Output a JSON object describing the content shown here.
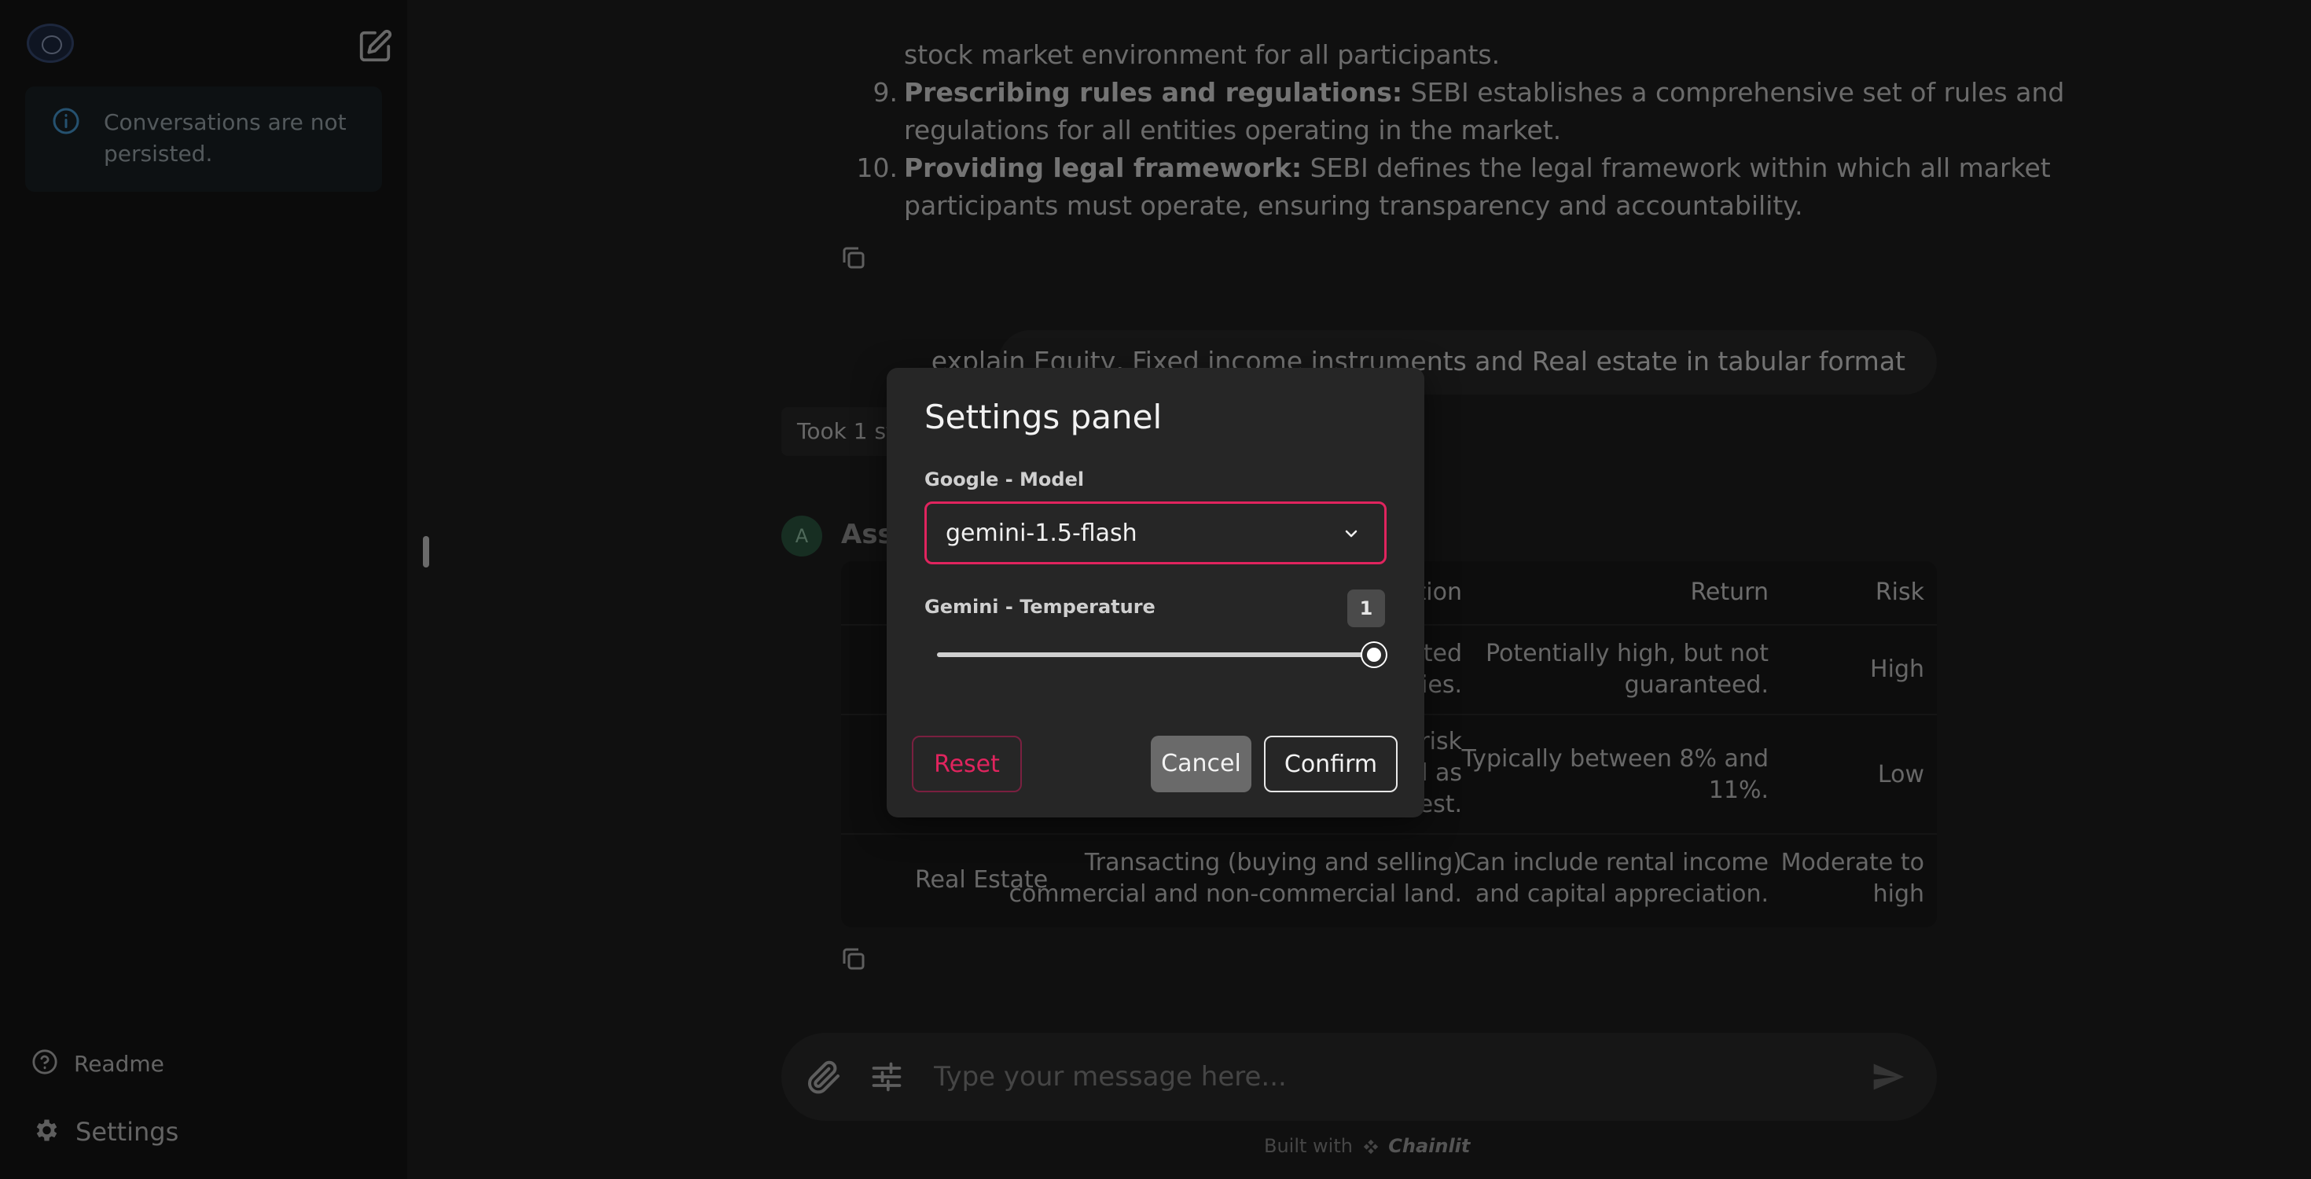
{
  "sidebar": {
    "logo": "app-logo",
    "info_notice": "Conversations are not persisted.",
    "readme_label": "Readme",
    "settings_label": "Settings"
  },
  "chat": {
    "prev_fragment": "stock market environment for all participants.",
    "list_items": [
      {
        "num": "9.",
        "bold": "Prescribing rules and regulations:",
        "line1": " SEBI establishes a comprehensive set of rules and",
        "line2": "regulations for all entities operating in the market."
      },
      {
        "num": "10.",
        "bold": "Providing legal framework:",
        "line1": " SEBI defines the legal framework within which all market",
        "line2": "participants must operate, ensuring transparency and accountability."
      }
    ],
    "user_message": "explain Equity, Fixed income instruments and Real estate in tabular format",
    "took_steps": "Took 1 step",
    "assistant_avatar": "A",
    "assistant_name": "Assistant",
    "table": {
      "headers": [
        "Description",
        "Return",
        "Risk"
      ],
      "rows": [
        {
          "col2a": "...sted",
          "col2b": "...ies.",
          "ret1": "Potentially high, but not",
          "ret2": "guaranteed.",
          "risk1": "High",
          "risk2": ""
        },
        {
          "col2a": "...risk",
          "col2b": "...d as",
          "col2c": "...est.",
          "ret1": "Typically between 8% and",
          "ret2": "11%.",
          "risk1": "Low",
          "risk2": ""
        },
        {
          "name": "Real Estate",
          "col2a": "Transacting (buying and selling)",
          "col2b": "commercial and non-commercial land.",
          "ret1": "Can include rental income",
          "ret2": "and capital appreciation.",
          "risk1": "Moderate to",
          "risk2": "high"
        }
      ]
    }
  },
  "composer": {
    "placeholder": "Type your message here...",
    "built_with": "Built with",
    "brand": "Chainlit"
  },
  "modal": {
    "title": "Settings panel",
    "model_label": "Google - Model",
    "model_value": "gemini-1.5-flash",
    "temp_label": "Gemini - Temperature",
    "temp_value": "1",
    "temp_fraction": 1.0,
    "reset_label": "Reset",
    "cancel_label": "Cancel",
    "confirm_label": "Confirm"
  },
  "colors": {
    "accent": "#e0245e",
    "background": "#212121",
    "sidebar": "#171717"
  }
}
